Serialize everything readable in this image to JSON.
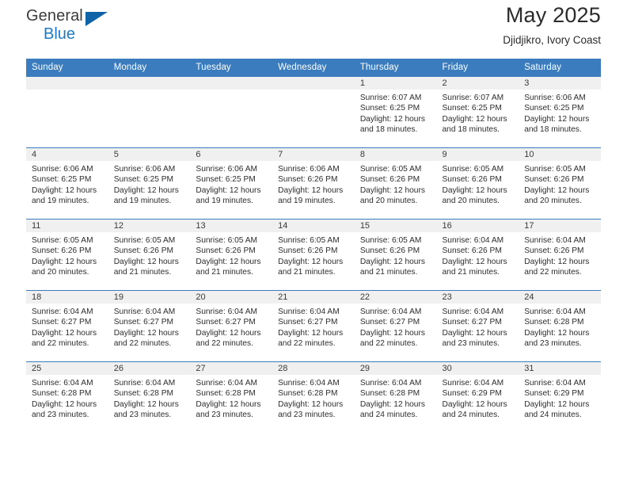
{
  "brand": {
    "name_top": "General",
    "name_bottom": "Blue",
    "color_dark": "#3c3c3c",
    "color_blue": "#1f7ac4",
    "triangle_color": "#1163a8"
  },
  "header": {
    "title": "May 2025",
    "subtitle": "Djidjikro, Ivory Coast"
  },
  "theme": {
    "header_band": "#3b7cbf",
    "daynum_band": "#f0f0f0",
    "text": "#2d2d2d"
  },
  "labels": {
    "sunrise_prefix": "Sunrise:",
    "sunset_prefix": "Sunset:",
    "daylight_prefix": "Daylight:"
  },
  "weekdays": [
    "Sunday",
    "Monday",
    "Tuesday",
    "Wednesday",
    "Thursday",
    "Friday",
    "Saturday"
  ],
  "weeks": [
    [
      {
        "day": "",
        "sunrise": "",
        "sunset": "",
        "daylight_1": "",
        "daylight_2": "",
        "empty": true
      },
      {
        "day": "",
        "sunrise": "",
        "sunset": "",
        "daylight_1": "",
        "daylight_2": "",
        "empty": true
      },
      {
        "day": "",
        "sunrise": "",
        "sunset": "",
        "daylight_1": "",
        "daylight_2": "",
        "empty": true
      },
      {
        "day": "",
        "sunrise": "",
        "sunset": "",
        "daylight_1": "",
        "daylight_2": "",
        "empty": true
      },
      {
        "day": "1",
        "sunrise": "Sunrise: 6:07 AM",
        "sunset": "Sunset: 6:25 PM",
        "daylight_1": "Daylight: 12 hours",
        "daylight_2": "and 18 minutes."
      },
      {
        "day": "2",
        "sunrise": "Sunrise: 6:07 AM",
        "sunset": "Sunset: 6:25 PM",
        "daylight_1": "Daylight: 12 hours",
        "daylight_2": "and 18 minutes."
      },
      {
        "day": "3",
        "sunrise": "Sunrise: 6:06 AM",
        "sunset": "Sunset: 6:25 PM",
        "daylight_1": "Daylight: 12 hours",
        "daylight_2": "and 18 minutes."
      }
    ],
    [
      {
        "day": "4",
        "sunrise": "Sunrise: 6:06 AM",
        "sunset": "Sunset: 6:25 PM",
        "daylight_1": "Daylight: 12 hours",
        "daylight_2": "and 19 minutes."
      },
      {
        "day": "5",
        "sunrise": "Sunrise: 6:06 AM",
        "sunset": "Sunset: 6:25 PM",
        "daylight_1": "Daylight: 12 hours",
        "daylight_2": "and 19 minutes."
      },
      {
        "day": "6",
        "sunrise": "Sunrise: 6:06 AM",
        "sunset": "Sunset: 6:25 PM",
        "daylight_1": "Daylight: 12 hours",
        "daylight_2": "and 19 minutes."
      },
      {
        "day": "7",
        "sunrise": "Sunrise: 6:06 AM",
        "sunset": "Sunset: 6:26 PM",
        "daylight_1": "Daylight: 12 hours",
        "daylight_2": "and 19 minutes."
      },
      {
        "day": "8",
        "sunrise": "Sunrise: 6:05 AM",
        "sunset": "Sunset: 6:26 PM",
        "daylight_1": "Daylight: 12 hours",
        "daylight_2": "and 20 minutes."
      },
      {
        "day": "9",
        "sunrise": "Sunrise: 6:05 AM",
        "sunset": "Sunset: 6:26 PM",
        "daylight_1": "Daylight: 12 hours",
        "daylight_2": "and 20 minutes."
      },
      {
        "day": "10",
        "sunrise": "Sunrise: 6:05 AM",
        "sunset": "Sunset: 6:26 PM",
        "daylight_1": "Daylight: 12 hours",
        "daylight_2": "and 20 minutes."
      }
    ],
    [
      {
        "day": "11",
        "sunrise": "Sunrise: 6:05 AM",
        "sunset": "Sunset: 6:26 PM",
        "daylight_1": "Daylight: 12 hours",
        "daylight_2": "and 20 minutes."
      },
      {
        "day": "12",
        "sunrise": "Sunrise: 6:05 AM",
        "sunset": "Sunset: 6:26 PM",
        "daylight_1": "Daylight: 12 hours",
        "daylight_2": "and 21 minutes."
      },
      {
        "day": "13",
        "sunrise": "Sunrise: 6:05 AM",
        "sunset": "Sunset: 6:26 PM",
        "daylight_1": "Daylight: 12 hours",
        "daylight_2": "and 21 minutes."
      },
      {
        "day": "14",
        "sunrise": "Sunrise: 6:05 AM",
        "sunset": "Sunset: 6:26 PM",
        "daylight_1": "Daylight: 12 hours",
        "daylight_2": "and 21 minutes."
      },
      {
        "day": "15",
        "sunrise": "Sunrise: 6:05 AM",
        "sunset": "Sunset: 6:26 PM",
        "daylight_1": "Daylight: 12 hours",
        "daylight_2": "and 21 minutes."
      },
      {
        "day": "16",
        "sunrise": "Sunrise: 6:04 AM",
        "sunset": "Sunset: 6:26 PM",
        "daylight_1": "Daylight: 12 hours",
        "daylight_2": "and 21 minutes."
      },
      {
        "day": "17",
        "sunrise": "Sunrise: 6:04 AM",
        "sunset": "Sunset: 6:26 PM",
        "daylight_1": "Daylight: 12 hours",
        "daylight_2": "and 22 minutes."
      }
    ],
    [
      {
        "day": "18",
        "sunrise": "Sunrise: 6:04 AM",
        "sunset": "Sunset: 6:27 PM",
        "daylight_1": "Daylight: 12 hours",
        "daylight_2": "and 22 minutes."
      },
      {
        "day": "19",
        "sunrise": "Sunrise: 6:04 AM",
        "sunset": "Sunset: 6:27 PM",
        "daylight_1": "Daylight: 12 hours",
        "daylight_2": "and 22 minutes."
      },
      {
        "day": "20",
        "sunrise": "Sunrise: 6:04 AM",
        "sunset": "Sunset: 6:27 PM",
        "daylight_1": "Daylight: 12 hours",
        "daylight_2": "and 22 minutes."
      },
      {
        "day": "21",
        "sunrise": "Sunrise: 6:04 AM",
        "sunset": "Sunset: 6:27 PM",
        "daylight_1": "Daylight: 12 hours",
        "daylight_2": "and 22 minutes."
      },
      {
        "day": "22",
        "sunrise": "Sunrise: 6:04 AM",
        "sunset": "Sunset: 6:27 PM",
        "daylight_1": "Daylight: 12 hours",
        "daylight_2": "and 22 minutes."
      },
      {
        "day": "23",
        "sunrise": "Sunrise: 6:04 AM",
        "sunset": "Sunset: 6:27 PM",
        "daylight_1": "Daylight: 12 hours",
        "daylight_2": "and 23 minutes."
      },
      {
        "day": "24",
        "sunrise": "Sunrise: 6:04 AM",
        "sunset": "Sunset: 6:28 PM",
        "daylight_1": "Daylight: 12 hours",
        "daylight_2": "and 23 minutes."
      }
    ],
    [
      {
        "day": "25",
        "sunrise": "Sunrise: 6:04 AM",
        "sunset": "Sunset: 6:28 PM",
        "daylight_1": "Daylight: 12 hours",
        "daylight_2": "and 23 minutes."
      },
      {
        "day": "26",
        "sunrise": "Sunrise: 6:04 AM",
        "sunset": "Sunset: 6:28 PM",
        "daylight_1": "Daylight: 12 hours",
        "daylight_2": "and 23 minutes."
      },
      {
        "day": "27",
        "sunrise": "Sunrise: 6:04 AM",
        "sunset": "Sunset: 6:28 PM",
        "daylight_1": "Daylight: 12 hours",
        "daylight_2": "and 23 minutes."
      },
      {
        "day": "28",
        "sunrise": "Sunrise: 6:04 AM",
        "sunset": "Sunset: 6:28 PM",
        "daylight_1": "Daylight: 12 hours",
        "daylight_2": "and 23 minutes."
      },
      {
        "day": "29",
        "sunrise": "Sunrise: 6:04 AM",
        "sunset": "Sunset: 6:28 PM",
        "daylight_1": "Daylight: 12 hours",
        "daylight_2": "and 24 minutes."
      },
      {
        "day": "30",
        "sunrise": "Sunrise: 6:04 AM",
        "sunset": "Sunset: 6:29 PM",
        "daylight_1": "Daylight: 12 hours",
        "daylight_2": "and 24 minutes."
      },
      {
        "day": "31",
        "sunrise": "Sunrise: 6:04 AM",
        "sunset": "Sunset: 6:29 PM",
        "daylight_1": "Daylight: 12 hours",
        "daylight_2": "and 24 minutes."
      }
    ]
  ]
}
